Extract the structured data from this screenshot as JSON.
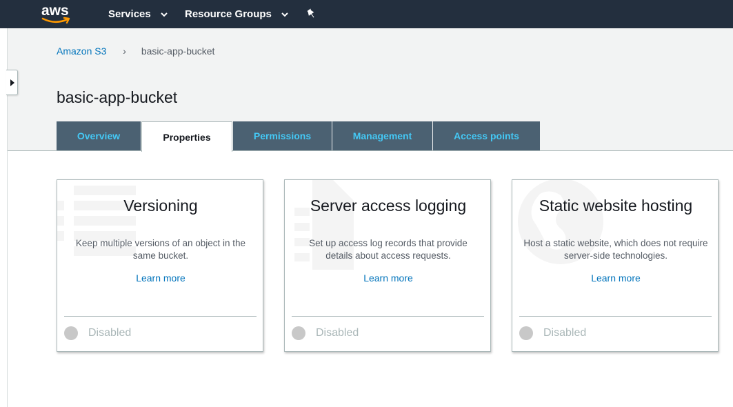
{
  "topnav": {
    "logo_text": "aws",
    "services_label": "Services",
    "resource_groups_label": "Resource Groups",
    "pin_icon": "pin-icon"
  },
  "breadcrumb": {
    "root": "Amazon S3",
    "separator": "›",
    "current": "basic-app-bucket"
  },
  "page": {
    "title": "basic-app-bucket"
  },
  "tabs": [
    {
      "label": "Overview",
      "active": false
    },
    {
      "label": "Properties",
      "active": true
    },
    {
      "label": "Permissions",
      "active": false
    },
    {
      "label": "Management",
      "active": false
    },
    {
      "label": "Access points",
      "active": false
    }
  ],
  "cards": [
    {
      "title": "Versioning",
      "description": "Keep multiple versions of an object in the same bucket.",
      "link": "Learn more",
      "status": "Disabled"
    },
    {
      "title": "Server access logging",
      "description": "Set up access log records that provide details about access requests.",
      "link": "Learn more",
      "status": "Disabled"
    },
    {
      "title": "Static website hosting",
      "description": "Host a static website, which does not require server-side technologies.",
      "link": "Learn more",
      "status": "Disabled"
    }
  ],
  "colors": {
    "topbar": "#232f3e",
    "tab_inactive_bg": "#4b6172",
    "tab_inactive_text": "#44c8f5",
    "link": "#0073bb",
    "header_bg": "#f2f3f3"
  }
}
